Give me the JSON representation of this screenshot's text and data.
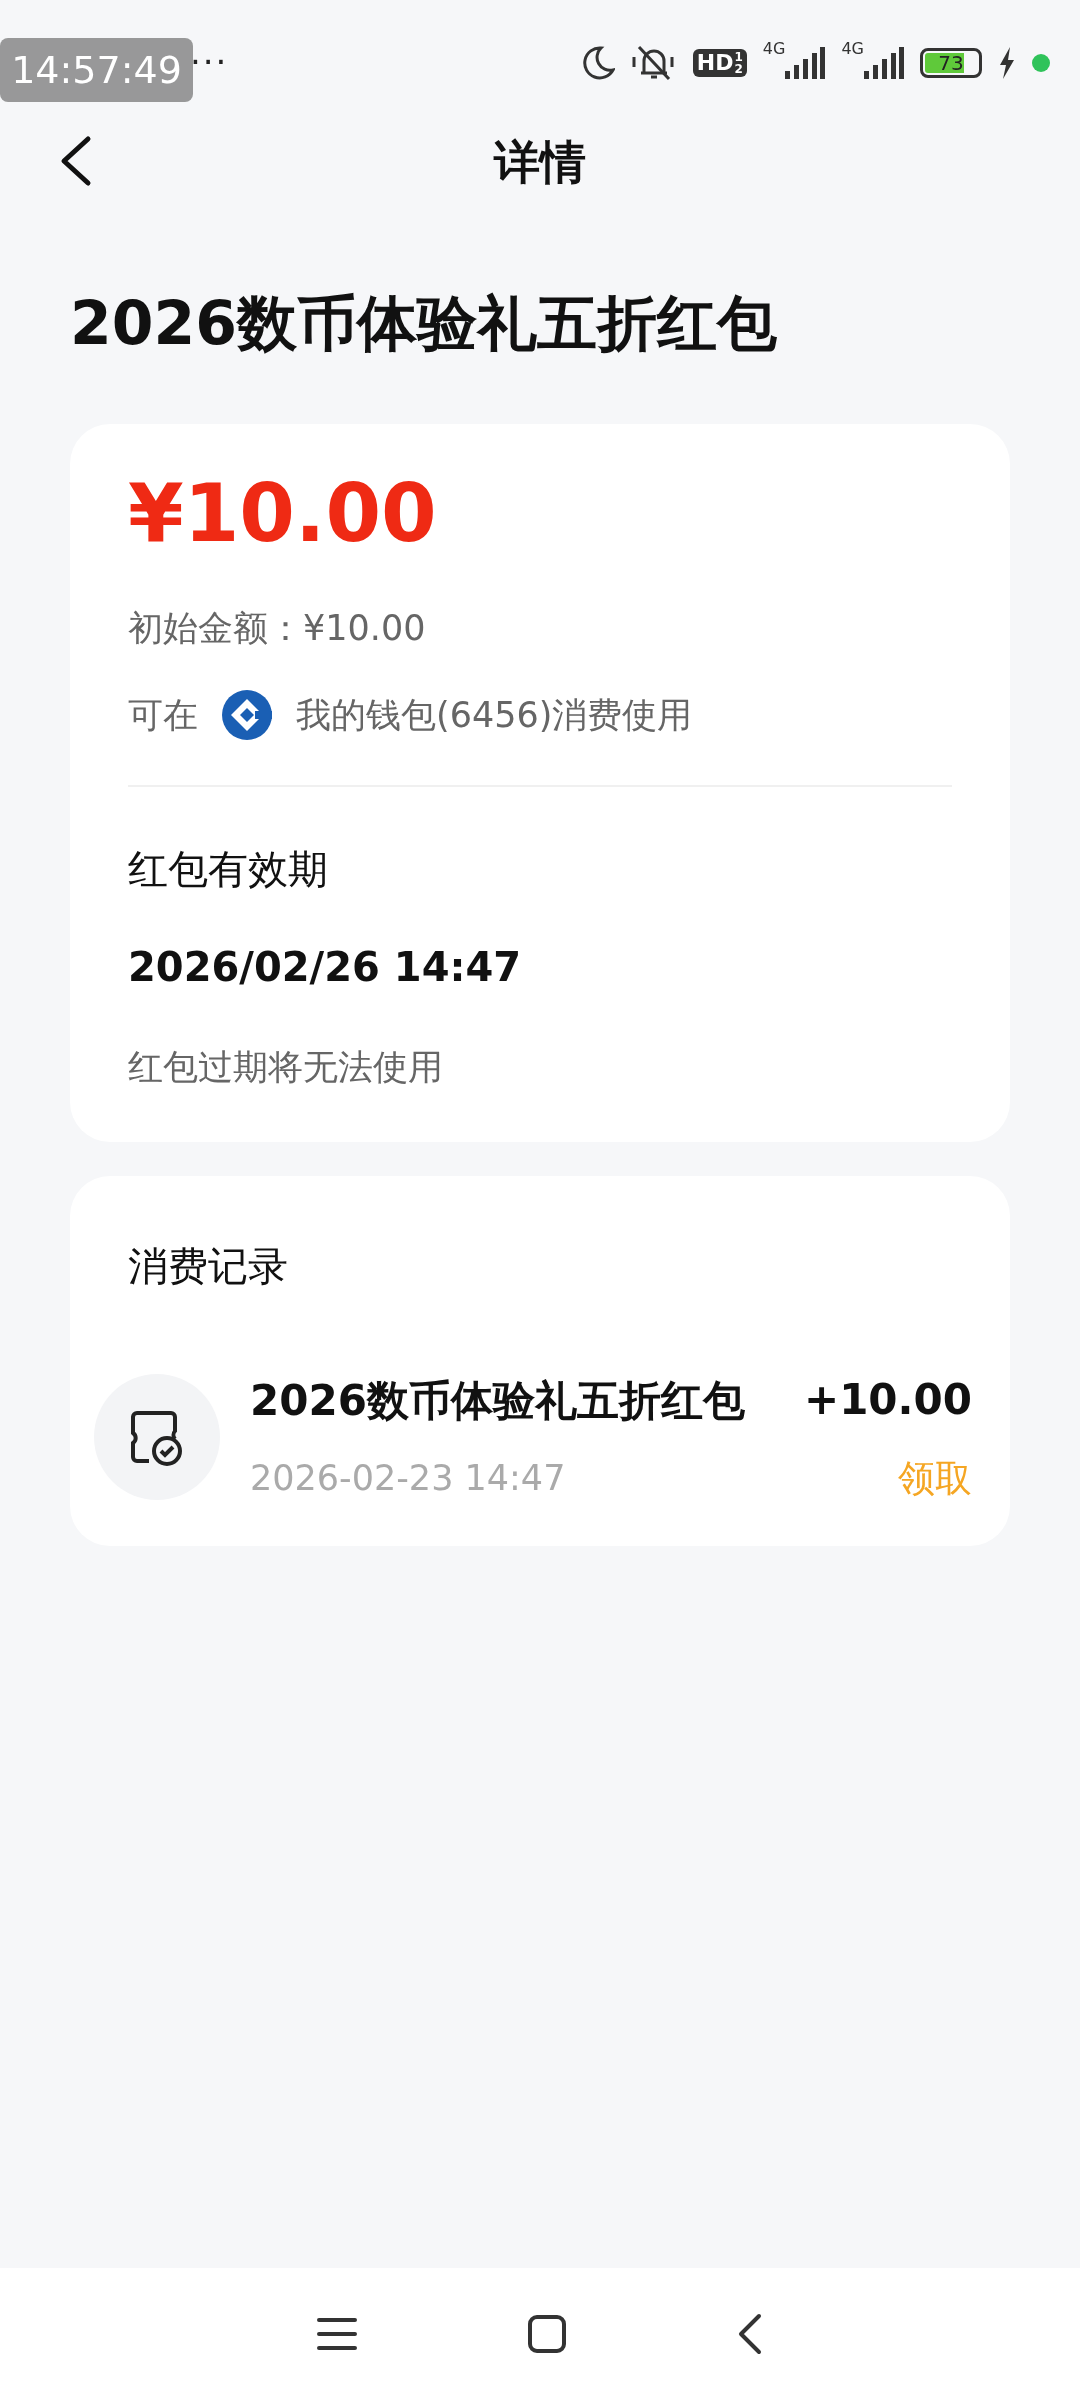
{
  "status_bar": {
    "overlay_time": "14:57:49",
    "more": "···",
    "hd_badge": {
      "label": "HD",
      "sup": "1",
      "sub": "2"
    },
    "networks": [
      "4G",
      "4G"
    ],
    "battery": "73"
  },
  "header": {
    "title": "详情"
  },
  "page_title": "2026数币体验礼五折红包",
  "detail_card": {
    "amount": "¥10.00",
    "initial_amount": "初始金额：¥10.00",
    "usable_prefix": "可在",
    "usable_wallet": "我的钱包(6456)消费使用",
    "validity_label": "红包有效期",
    "validity_date": "2026/02/26 14:47",
    "validity_note": "红包过期将无法使用"
  },
  "records_card": {
    "title": "消费记录",
    "records": [
      {
        "name": "2026数币体验礼五折红包",
        "time": "2026-02-23 14:47",
        "amount": "+10.00",
        "type": "领取"
      }
    ]
  }
}
